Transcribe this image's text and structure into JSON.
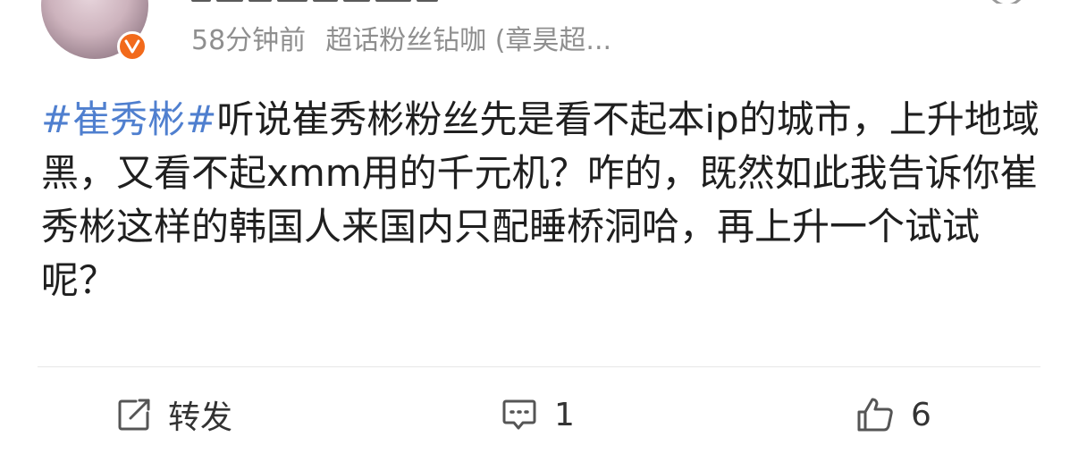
{
  "post": {
    "timestamp": "58分钟前",
    "source": "超话粉丝钻咖 (章昊超...",
    "topic": "#崔秀彬#",
    "text": "听说崔秀彬粉丝先是看不起本ip的城市，上升地域黑，又看不起xmm用的千元机？咋的，既然如此我告诉你崔秀彬这样的韩国人来国内只配睡桥洞哈，再上升一个试试呢？"
  },
  "actions": {
    "repost_label": "转发",
    "comment_count": "1",
    "like_count": "6"
  },
  "icons": {
    "verified": "verified-v-badge-icon",
    "repost": "repost-share-icon",
    "comment": "comment-bubble-icon",
    "like": "thumbs-up-icon"
  },
  "colors": {
    "topic_link": "#4f7fcf",
    "verified_badge": "#f26a1b",
    "meta_text": "#8f8f8f"
  }
}
